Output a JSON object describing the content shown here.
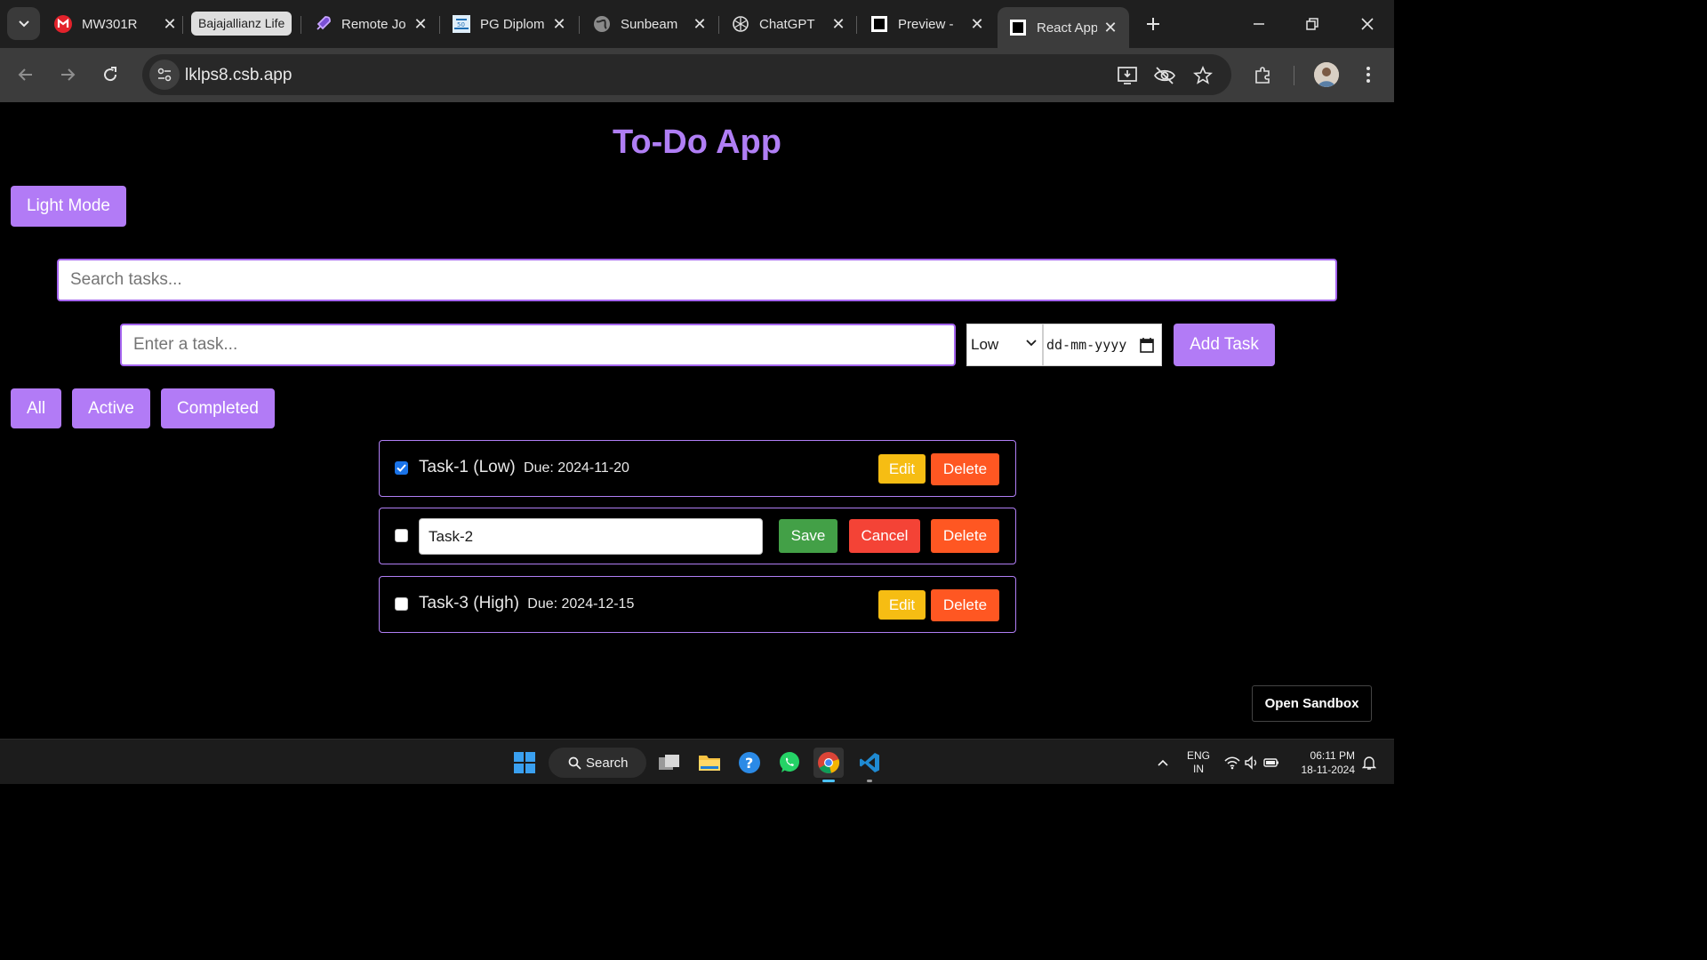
{
  "browser": {
    "tabs": [
      {
        "label": "MW301R",
        "icon": "mcafee-icon"
      },
      {
        "label": "Remote Jo",
        "icon": "rocket-icon"
      },
      {
        "label": "PG Diplom",
        "icon": "cdac-icon"
      },
      {
        "label": "Sunbeam",
        "icon": "globe-icon"
      },
      {
        "label": "ChatGPT",
        "icon": "chatgpt-icon"
      },
      {
        "label": "Preview -",
        "icon": "codesandbox-icon"
      },
      {
        "label": "React App",
        "icon": "codesandbox-icon"
      }
    ],
    "tab_group": "Bajajallianz Life",
    "url": "lklps8.csb.app"
  },
  "app": {
    "title": "To-Do App",
    "theme_button": "Light Mode",
    "search": {
      "placeholder": "Search tasks...",
      "value": ""
    },
    "new_task": {
      "placeholder": "Enter a task...",
      "value": ""
    },
    "priority": {
      "selected": "Low"
    },
    "date": {
      "placeholder": "dd-mm-yyyy"
    },
    "add_button": "Add Task",
    "filters": [
      "All",
      "Active",
      "Completed"
    ],
    "tasks": [
      {
        "completed": true,
        "name": "Task-1",
        "priority": "(Low)",
        "due": "Due: 2024-11-20",
        "edit": "Edit",
        "delete": "Delete"
      },
      {
        "completed": false,
        "editing_value": "Task-2",
        "save": "Save",
        "cancel": "Cancel",
        "delete": "Delete"
      },
      {
        "completed": false,
        "name": "Task-3",
        "priority": "(High)",
        "due": "Due: 2024-12-15",
        "edit": "Edit",
        "delete": "Delete"
      }
    ],
    "open_sandbox": "Open Sandbox"
  },
  "taskbar": {
    "search_label": "Search",
    "lang_top": "ENG",
    "lang_bottom": "IN",
    "time": "06:11 PM",
    "date": "18-11-2024"
  },
  "colors": {
    "accent": "#b27bf6",
    "edit": "#f6bd13",
    "delete": "#ff5722",
    "save": "#43a047",
    "cancel": "#f44336"
  }
}
